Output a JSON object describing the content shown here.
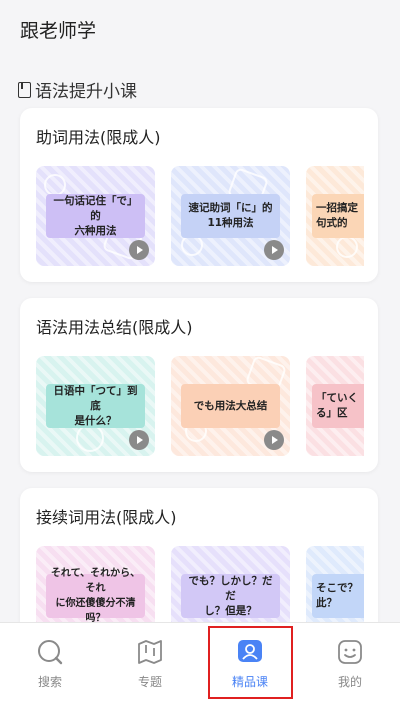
{
  "header": {
    "title": "跟老师学"
  },
  "section": {
    "title": "语法提升小课"
  },
  "cards": [
    {
      "title": "助词用法(限成人)",
      "items": [
        {
          "label": "一句话记住「で」的六种用法",
          "label_line1": "一句话记住「で」的",
          "label_line2": "六种用法",
          "bg": "#e4e1fb",
          "label_bg": "#cdbff5"
        },
        {
          "label": "速记助词「に」的11种用法",
          "label_line1": "速记助词「に」的",
          "label_line2": "11种用法",
          "bg": "#dfe6fb",
          "label_bg": "#c5d2f6"
        },
        {
          "label": "一招搞定「…句式的",
          "label_line1": "一招搞定「",
          "label_line2": "句式的",
          "bg": "#fde9d9",
          "label_bg": "#fbd6b6"
        }
      ]
    },
    {
      "title": "语法用法总结(限成人)",
      "items": [
        {
          "label": "日语中「つて」到底是什么？",
          "label_line1": "日语中「つて」到底",
          "label_line2": "是什么？",
          "bg": "#d8f3ef",
          "label_bg": "#a6e3da"
        },
        {
          "label": "でも用法大总结",
          "label_line1": "でも用法大总结",
          "label_line2": "",
          "bg": "#fde8dd",
          "label_bg": "#fbd0b6"
        },
        {
          "label": "「ていく…」区…",
          "label_line1": "「ていく",
          "label_line2": "る」区",
          "bg": "#fbe0e3",
          "label_bg": "#f6c2c8"
        }
      ]
    },
    {
      "title": "接续词用法(限成人)",
      "items": [
        {
          "label": "それて、それから、それに你还傻傻分不清吗？",
          "label_line1": "それて、それから、それ",
          "label_line2": "に你还傻傻分不清吗？",
          "bg": "#f7dff1",
          "label_bg": "#efc4e6"
        },
        {
          "label": "でも？しかし？だだし？但是？",
          "label_line1": "でも？しかし？だだ",
          "label_line2": "し？但是？",
          "bg": "#e6e0fb",
          "label_bg": "#d2c8f6"
        },
        {
          "label": "そこで？…此？",
          "label_line1": "そこで？",
          "label_line2": "此？",
          "bg": "#dfeafc",
          "label_bg": "#c2d6f8"
        }
      ]
    }
  ],
  "tabbar": {
    "tabs": [
      {
        "label": "搜索",
        "icon": "search-icon",
        "active": false
      },
      {
        "label": "专题",
        "icon": "map-icon",
        "active": false
      },
      {
        "label": "精品课",
        "icon": "user-badge-icon",
        "active": true
      },
      {
        "label": "我的",
        "icon": "smile-face-icon",
        "active": false
      }
    ],
    "active_color": "#4a83f5",
    "inactive_color": "#888888"
  },
  "annotation": {
    "highlight_color": "#e02020"
  }
}
